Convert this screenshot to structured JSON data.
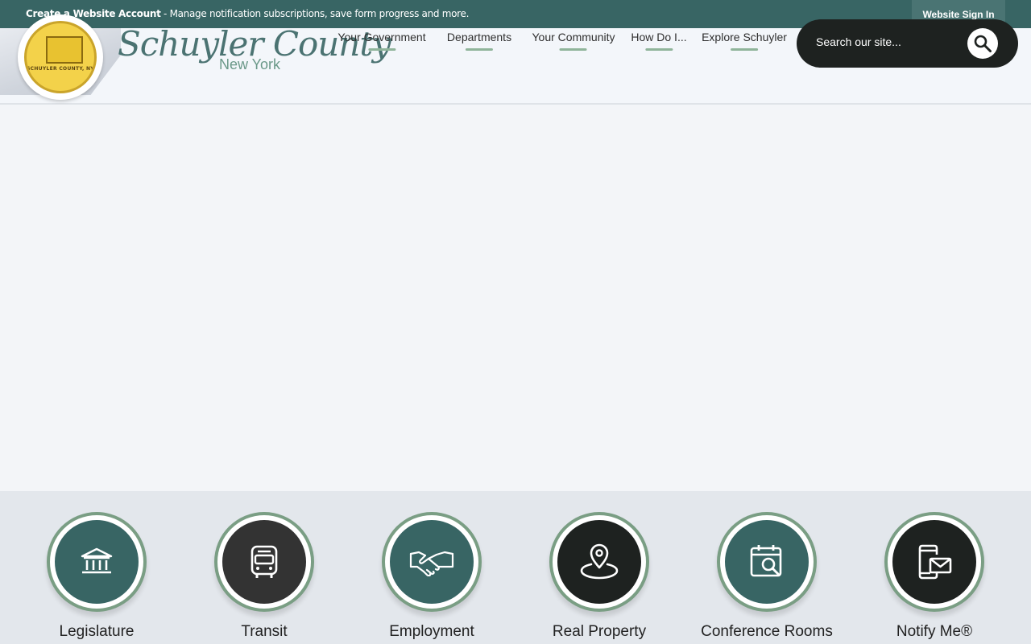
{
  "topbar": {
    "create_account": "Create a Website Account",
    "message": " - Manage notification subscriptions, save form progress and more.",
    "sign_in": "Website Sign In"
  },
  "brand": {
    "seal_text": "SCHUYLER COUNTY, NY",
    "name": "Schuyler County",
    "subtitle": "New York"
  },
  "nav": {
    "items": [
      {
        "label": "Your Government"
      },
      {
        "label": "Departments"
      },
      {
        "label": "Your Community"
      },
      {
        "label": "How Do I..."
      },
      {
        "label": "Explore Schuyler"
      }
    ]
  },
  "search": {
    "placeholder": "Search our site...",
    "icon": "search-icon"
  },
  "quicklinks": [
    {
      "label": "Legislature",
      "icon": "government-building-icon",
      "color": "#386564"
    },
    {
      "label": "Transit",
      "icon": "bus-icon",
      "color": "#333333"
    },
    {
      "label": "Employment",
      "icon": "handshake-icon",
      "color": "#386564"
    },
    {
      "label": "Real Property",
      "icon": "map-pin-icon",
      "color": "#1e2220"
    },
    {
      "label": "Conference Rooms",
      "icon": "calendar-search-icon",
      "color": "#386564"
    },
    {
      "label": "Notify Me®",
      "icon": "mobile-mail-icon",
      "color": "#1e2220"
    }
  ],
  "colors": {
    "topbar": "#386564",
    "accent": "#8fb49a",
    "dark": "#1e2220"
  }
}
